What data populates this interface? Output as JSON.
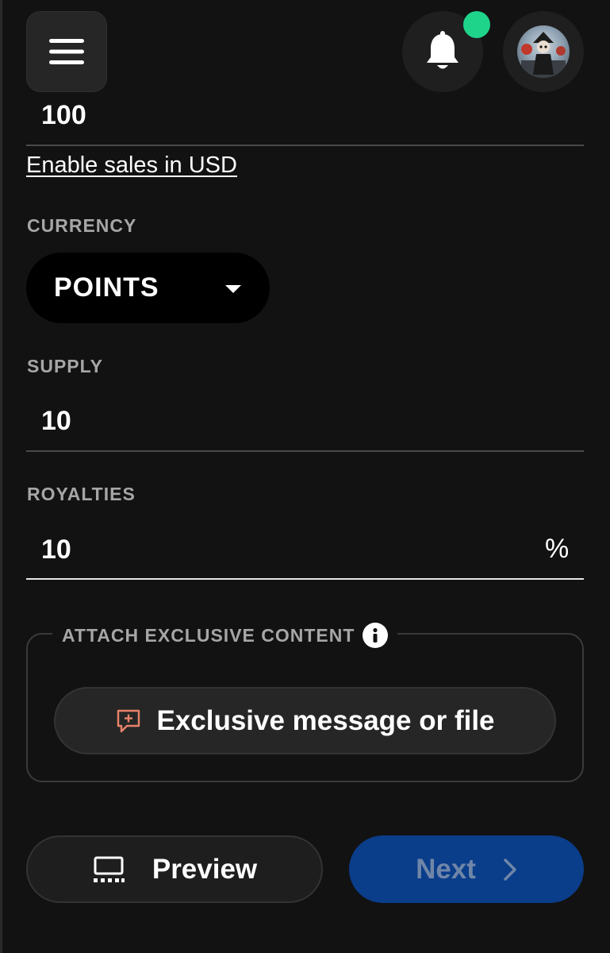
{
  "header": {
    "menu_icon": "hamburger-menu-icon",
    "bell_icon": "bell-icon",
    "notification_dot_color": "#1ed38a",
    "avatar": "user-avatar"
  },
  "price": {
    "value": "100",
    "enable_usd_link": "Enable sales in USD"
  },
  "currency": {
    "label": "CURRENCY",
    "selected": "POINTS"
  },
  "supply": {
    "label": "SUPPLY",
    "value": "10"
  },
  "royalties": {
    "label": "ROYALTIES",
    "value": "10",
    "suffix": "%"
  },
  "exclusive": {
    "legend": "ATTACH EXCLUSIVE CONTENT",
    "button_label": "Exclusive message or file",
    "button_icon_color": "#e8836a"
  },
  "actions": {
    "preview_label": "Preview",
    "next_label": "Next",
    "next_bg": "#0a3d8a"
  }
}
